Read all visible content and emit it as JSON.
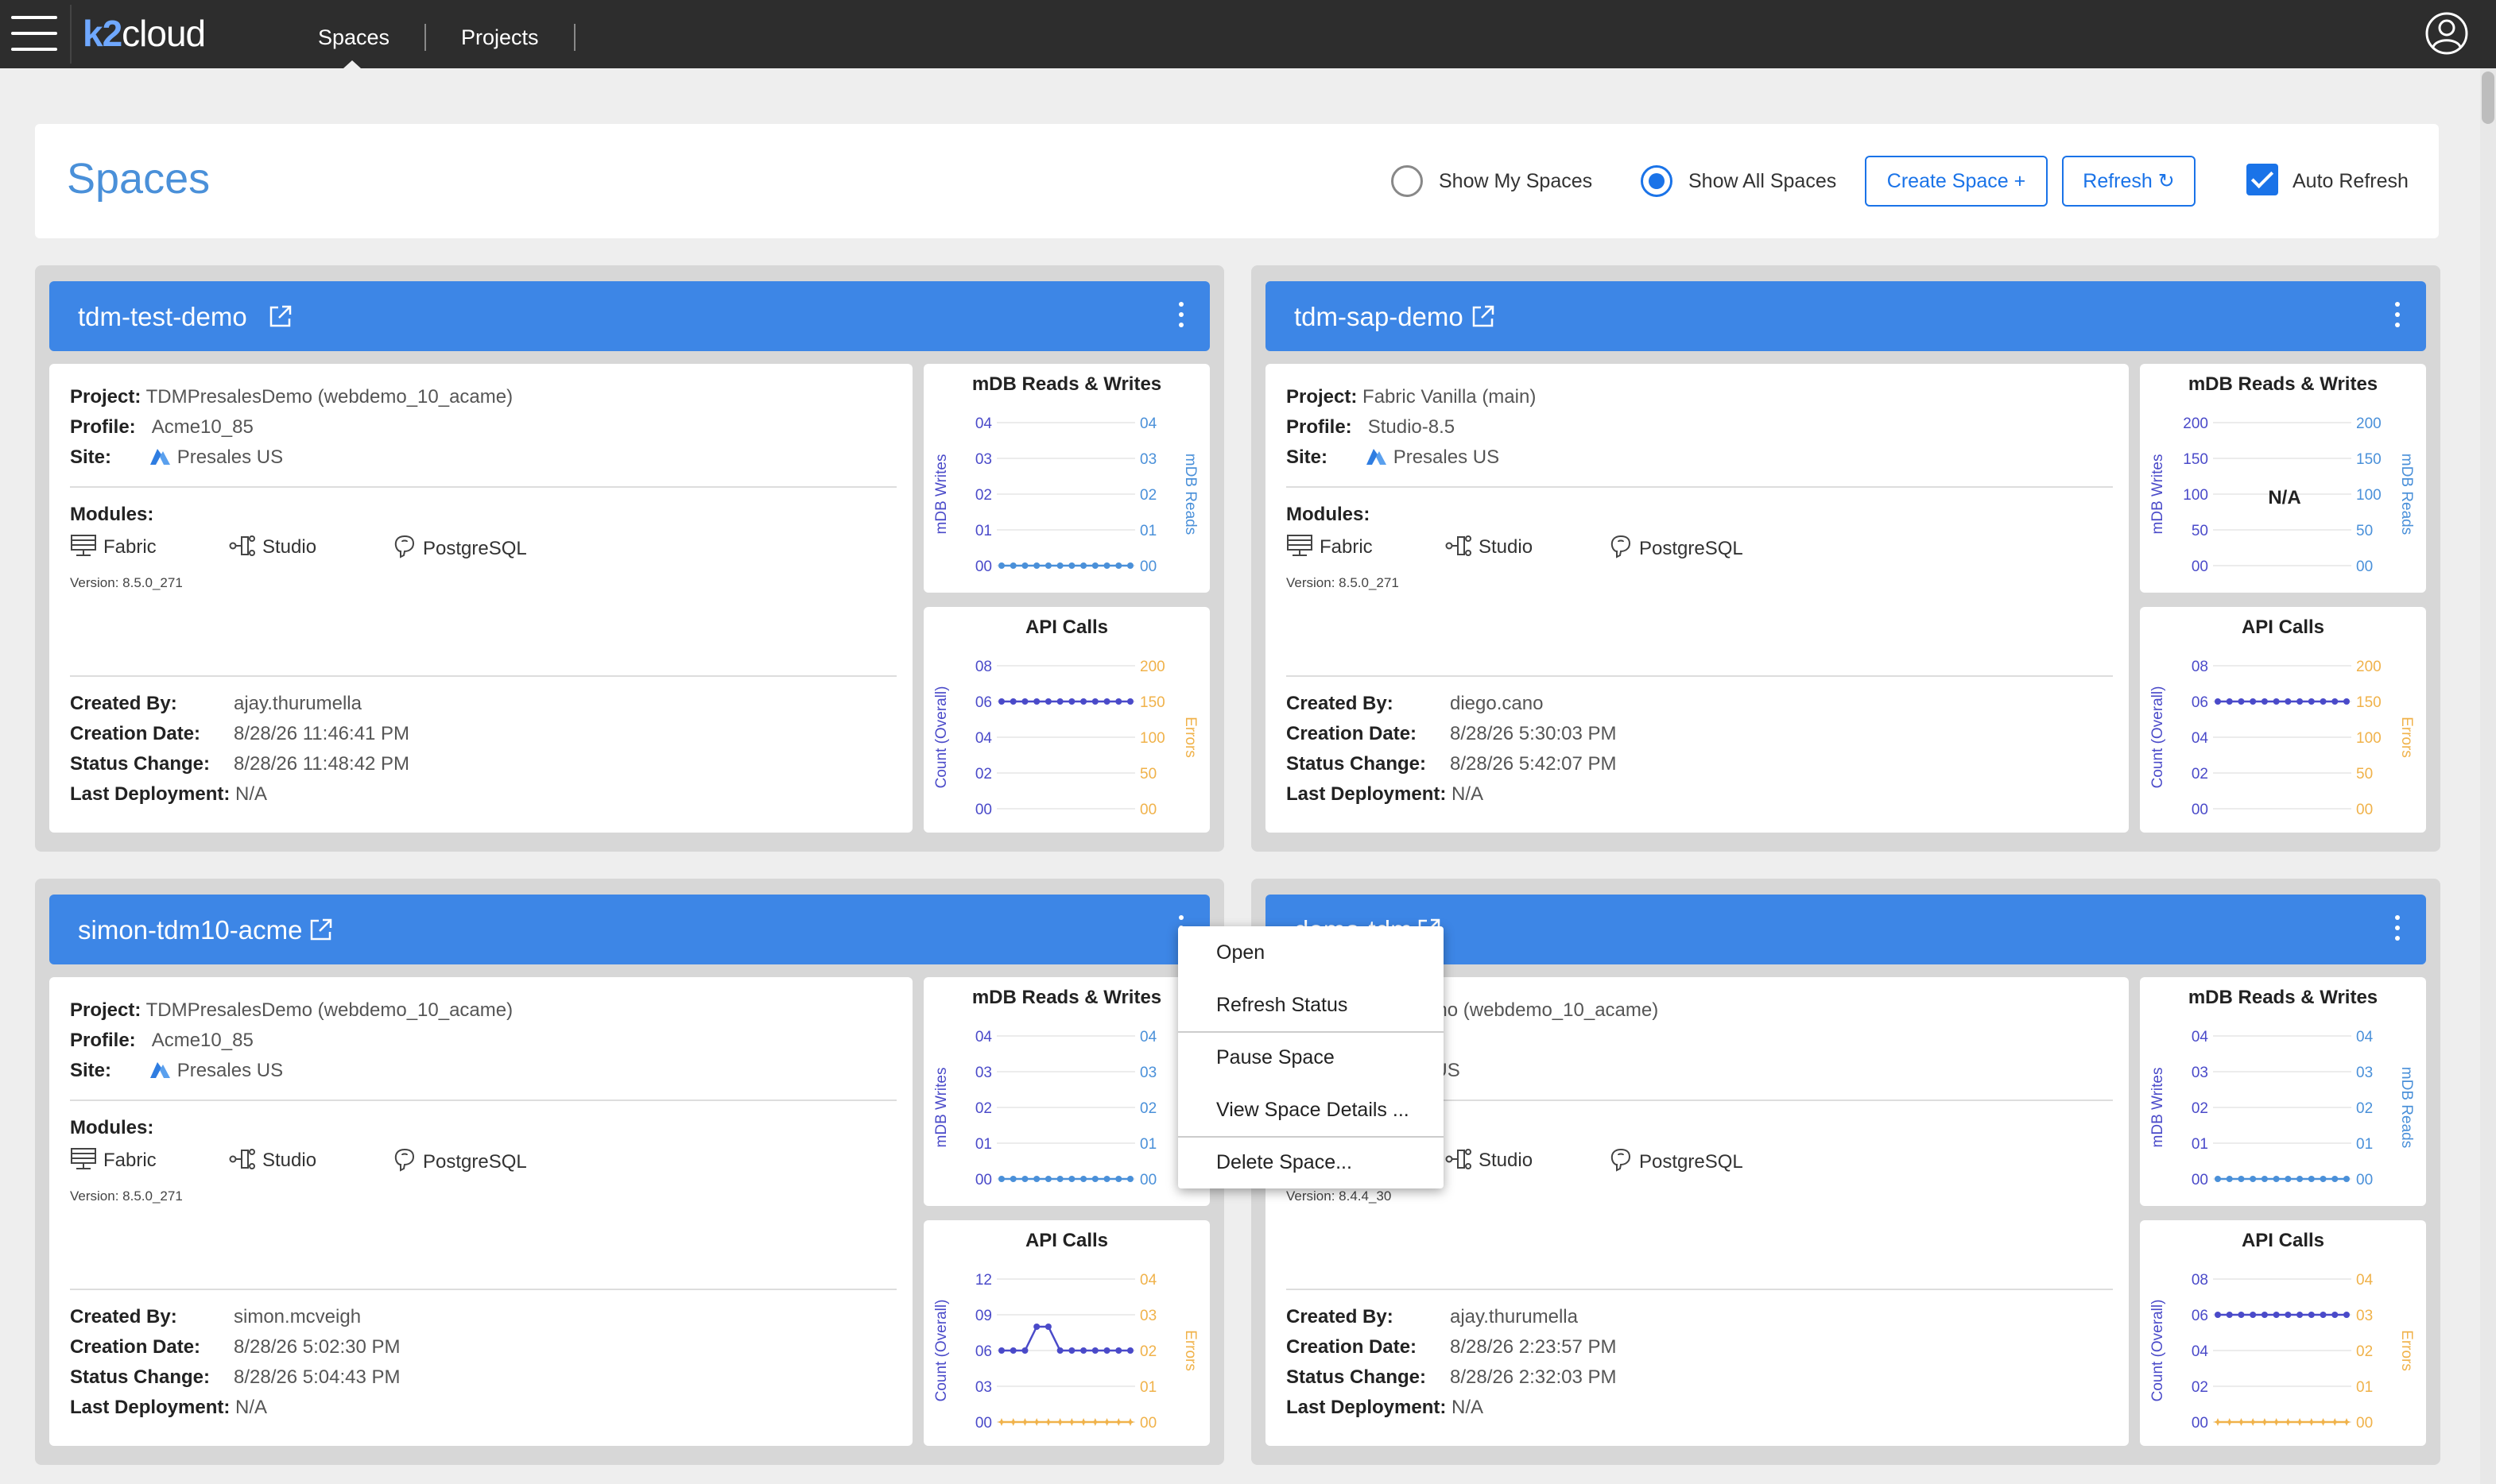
{
  "topbar": {
    "logo_k2": "k2",
    "logo_cloud": "cloud",
    "tabs": [
      {
        "label": "Spaces",
        "active": true
      },
      {
        "label": "Projects",
        "active": false
      }
    ]
  },
  "header": {
    "title": "Spaces",
    "show_my_spaces": "Show My Spaces",
    "show_all_spaces": "Show All Spaces",
    "selected_filter": "Show All Spaces",
    "create_space": "Create Space +",
    "refresh": "Refresh ↻",
    "auto_refresh": "Auto Refresh",
    "auto_refresh_checked": true
  },
  "labels": {
    "project": "Project:",
    "profile": "Profile:",
    "site": "Site:",
    "modules": "Modules:",
    "created_by": "Created By:",
    "creation_date": "Creation Date:",
    "status_change": "Status Change:",
    "last_deployment": "Last Deployment:"
  },
  "colors": {
    "accent": "#3d86e6",
    "primary_series": "#4a4ac9",
    "secondary_series": "#f0b24a",
    "reads_axis": "#4a90d9"
  },
  "spaces": [
    {
      "name": "tdm-test-demo",
      "project": "TDMPresalesDemo (webdemo_10_acame)",
      "profile": "Acme10_85",
      "site": "Presales US",
      "modules": [
        "Fabric",
        "Studio",
        "PostgreSQL"
      ],
      "version": "Version: 8.5.0_271",
      "created_by": "ajay.thurumella",
      "creation_date": "8/28/26 11:46:41 PM",
      "status_change": "8/28/26 11:48:42 PM",
      "last_deployment": "N/A"
    },
    {
      "name": "tdm-sap-demo",
      "project": "Fabric Vanilla (main)",
      "profile": "Studio-8.5",
      "site": "Presales US",
      "modules": [
        "Fabric",
        "Studio",
        "PostgreSQL"
      ],
      "version": "Version: 8.5.0_271",
      "created_by": "diego.cano",
      "creation_date": "8/28/26 5:30:03 PM",
      "status_change": "8/28/26 5:42:07 PM",
      "last_deployment": "N/A"
    },
    {
      "name": "simon-tdm10-acme",
      "project": "TDMPresalesDemo (webdemo_10_acame)",
      "profile": "Acme10_85",
      "site": "Presales US",
      "modules": [
        "Fabric",
        "Studio",
        "PostgreSQL"
      ],
      "version": "Version: 8.5.0_271",
      "created_by": "simon.mcveigh",
      "creation_date": "8/28/26 5:02:30 PM",
      "status_change": "8/28/26 5:04:43 PM",
      "last_deployment": "N/A"
    },
    {
      "name": "demo-tdm",
      "project": "salesDemo (webdemo_10_acame)",
      "profile": "",
      "site": "ales US",
      "modules": [
        "",
        "Studio",
        "PostgreSQL"
      ],
      "version": "Version: 8.4.4_30",
      "created_by": "ajay.thurumella",
      "creation_date": "8/28/26 2:23:57 PM",
      "status_change": "8/28/26 2:32:03 PM",
      "last_deployment": "N/A"
    }
  ],
  "chart_data": [
    {
      "space": "tdm-test-demo",
      "type": "line",
      "title": "mDB Reads & Writes",
      "ylabel": "mDB Writes",
      "y2label": "mDB Reads",
      "yticks": [
        "00",
        "01",
        "02",
        "03",
        "04"
      ],
      "y2ticks": [
        "00",
        "01",
        "02",
        "03",
        "04"
      ],
      "ylim": [
        0,
        4
      ],
      "y2lim": [
        0,
        4
      ],
      "series": [
        {
          "values": [
            0,
            0,
            0,
            0,
            0,
            0,
            0,
            0,
            0,
            0,
            0,
            0
          ],
          "axis": "y2"
        }
      ]
    },
    {
      "space": "tdm-test-demo",
      "type": "line",
      "title": "API Calls",
      "ylabel": "Count (Overall)",
      "y2label": "Errors",
      "yticks": [
        "00",
        "02",
        "04",
        "06",
        "08"
      ],
      "y2ticks": [
        "00",
        "50",
        "100",
        "150",
        "200"
      ],
      "ylim": [
        0,
        8
      ],
      "y2lim": [
        0,
        200
      ],
      "series": [
        {
          "values": [
            6,
            6,
            6,
            6,
            6,
            6,
            6,
            6,
            6,
            6,
            6,
            6
          ],
          "axis": "y"
        }
      ]
    },
    {
      "space": "tdm-sap-demo",
      "type": "line",
      "title": "mDB Reads & Writes",
      "ylabel": "mDB Writes",
      "y2label": "mDB Reads",
      "yticks": [
        "00",
        "50",
        "100",
        "150",
        "200"
      ],
      "y2ticks": [
        "00",
        "50",
        "100",
        "150",
        "200"
      ],
      "ylim": [
        0,
        200
      ],
      "y2lim": [
        0,
        200
      ],
      "na": "N/A",
      "series": []
    },
    {
      "space": "tdm-sap-demo",
      "type": "line",
      "title": "API Calls",
      "ylabel": "Count (Overall)",
      "y2label": "Errors",
      "yticks": [
        "00",
        "02",
        "04",
        "06",
        "08"
      ],
      "y2ticks": [
        "00",
        "50",
        "100",
        "150",
        "200"
      ],
      "ylim": [
        0,
        8
      ],
      "y2lim": [
        0,
        200
      ],
      "series": [
        {
          "values": [
            6,
            6,
            6,
            6,
            6,
            6,
            6,
            6,
            6,
            6,
            6,
            6
          ],
          "axis": "y"
        }
      ]
    },
    {
      "space": "simon-tdm10-acme",
      "type": "line",
      "title": "mDB Reads & Writes",
      "ylabel": "mDB Writes",
      "y2label": "mDB Reads",
      "yticks": [
        "00",
        "01",
        "02",
        "03",
        "04"
      ],
      "y2ticks": [
        "00",
        "01",
        "02",
        "03",
        "04"
      ],
      "ylim": [
        0,
        4
      ],
      "y2lim": [
        0,
        4
      ],
      "series": [
        {
          "values": [
            0,
            0,
            0,
            0,
            0,
            0,
            0,
            0,
            0,
            0,
            0,
            0
          ],
          "axis": "y2"
        }
      ]
    },
    {
      "space": "simon-tdm10-acme",
      "type": "line",
      "title": "API Calls",
      "ylabel": "Count (Overall)",
      "y2label": "Errors",
      "yticks": [
        "00",
        "03",
        "06",
        "09",
        "12"
      ],
      "y2ticks": [
        "00",
        "01",
        "02",
        "03",
        "04"
      ],
      "ylim": [
        0,
        12
      ],
      "y2lim": [
        0,
        4
      ],
      "series": [
        {
          "values": [
            6,
            6,
            6,
            8,
            8,
            6,
            6,
            6,
            6,
            6,
            6,
            6
          ],
          "axis": "y"
        },
        {
          "values": [
            0,
            0,
            0,
            0,
            0,
            0,
            0,
            0,
            0,
            0,
            0,
            0
          ],
          "axis": "y2"
        }
      ]
    },
    {
      "space": "demo-tdm",
      "type": "line",
      "title": "mDB Reads & Writes",
      "ylabel": "mDB Writes",
      "y2label": "mDB Reads",
      "yticks": [
        "00",
        "01",
        "02",
        "03",
        "04"
      ],
      "y2ticks": [
        "00",
        "01",
        "02",
        "03",
        "04"
      ],
      "ylim": [
        0,
        4
      ],
      "y2lim": [
        0,
        4
      ],
      "series": [
        {
          "values": [
            0,
            0,
            0,
            0,
            0,
            0,
            0,
            0,
            0,
            0,
            0,
            0
          ],
          "axis": "y2"
        }
      ]
    },
    {
      "space": "demo-tdm",
      "type": "line",
      "title": "API Calls",
      "ylabel": "Count (Overall)",
      "y2label": "Errors",
      "yticks": [
        "00",
        "02",
        "04",
        "06",
        "08"
      ],
      "y2ticks": [
        "00",
        "01",
        "02",
        "03",
        "04"
      ],
      "ylim": [
        0,
        8
      ],
      "y2lim": [
        0,
        4
      ],
      "series": [
        {
          "values": [
            6,
            6,
            6,
            6,
            6,
            6,
            6,
            6,
            6,
            6,
            6,
            6
          ],
          "axis": "y"
        },
        {
          "values": [
            0,
            0,
            0,
            0,
            0,
            0,
            0,
            0,
            0,
            0,
            0,
            0
          ],
          "axis": "y2"
        }
      ]
    }
  ],
  "context_menu": {
    "items": [
      "Open",
      "Refresh Status",
      "Pause Space",
      "View Space Details ...",
      "Delete Space..."
    ]
  }
}
